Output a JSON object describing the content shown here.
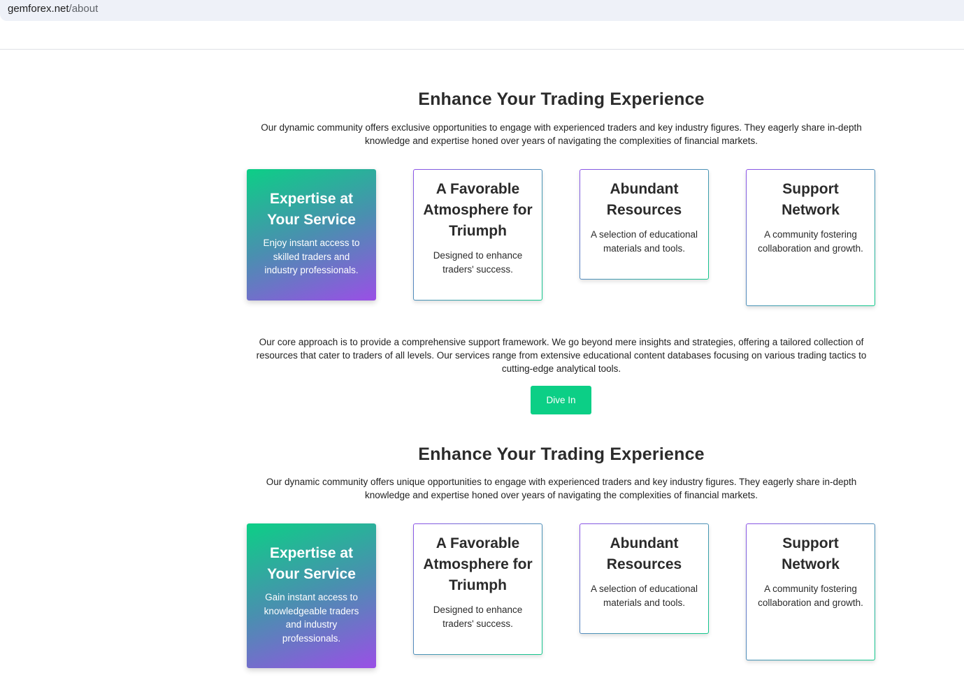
{
  "browser": {
    "url_host": "gemforex.net",
    "url_path": "/about"
  },
  "sections": [
    {
      "title": "Enhance Your Trading Experience",
      "description": "Our dynamic community offers exclusive opportunities to engage with experienced traders and key industry figures. They eagerly share in-depth knowledge and expertise honed over years of navigating the complexities of financial markets.",
      "cards": [
        {
          "title": "Expertise at Your Service",
          "text": "Enjoy instant access to skilled traders and industry professionals."
        },
        {
          "title": "A Favorable Atmosphere for Triumph",
          "text": "Designed to enhance traders' success."
        },
        {
          "title": "Abundant Resources",
          "text": "A selection of educational materials and tools."
        },
        {
          "title": "Support Network",
          "text": "A community fostering collaboration and growth."
        }
      ],
      "body": "Our core approach is to provide a comprehensive support framework. We go beyond mere insights and strategies, offering a tailored collection of resources that cater to traders of all levels. Our services range from extensive educational content databases focusing on various trading tactics to cutting-edge analytical tools.",
      "button_label": "Dive In"
    },
    {
      "title": "Enhance Your Trading Experience",
      "description": "Our dynamic community offers unique opportunities to engage with experienced traders and key industry figures. They eagerly share in-depth knowledge and expertise honed over years of navigating the complexities of financial markets.",
      "cards": [
        {
          "title": "Expertise at Your Service",
          "text": "Gain instant access to knowledgeable traders and industry professionals."
        },
        {
          "title": "A Favorable Atmosphere for Triumph",
          "text": "Designed to enhance traders' success."
        },
        {
          "title": "Abundant Resources",
          "text": "A selection of educational materials and tools."
        },
        {
          "title": "Support Network",
          "text": "A community fostering collaboration and growth."
        }
      ]
    }
  ],
  "colors": {
    "accent_green": "#0ccf86",
    "accent_purple": "#9a4fe6"
  }
}
